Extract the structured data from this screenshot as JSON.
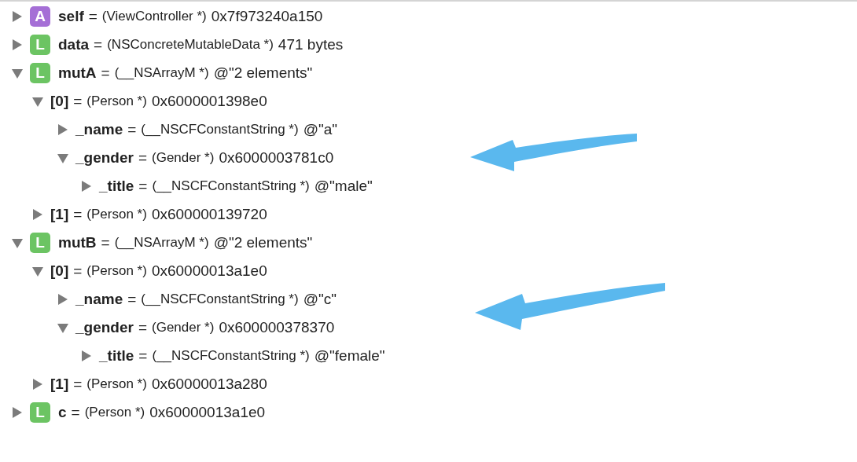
{
  "variables": [
    {
      "name": "self",
      "equals": "=",
      "type": "(ViewController *)",
      "value": "0x7f973240a150",
      "expanded": false,
      "badge": {
        "letter": "A",
        "color": "#a56fd6"
      }
    },
    {
      "name": "data",
      "equals": "=",
      "type": "(NSConcreteMutableData *)",
      "value": "471 bytes",
      "expanded": false,
      "badge": {
        "letter": "L",
        "color": "#6cc463"
      }
    },
    {
      "name": "mutA",
      "equals": "=",
      "type": "(__NSArrayM *)",
      "value": "@\"2 elements\"",
      "expanded": true,
      "badge": {
        "letter": "L",
        "color": "#6cc463"
      },
      "children": [
        {
          "name": "[0]",
          "equals": "=",
          "type": "(Person *)",
          "value": "0x6000001398e0",
          "expanded": true,
          "children": [
            {
              "name": "_name",
              "equals": "=",
              "type": "(__NSCFConstantString *)",
              "value": "@\"a\"",
              "expanded": false
            },
            {
              "name": "_gender",
              "equals": "=",
              "type": "(Gender *)",
              "value": "0x6000003781c0",
              "expanded": true,
              "children": [
                {
                  "name": "_title",
                  "equals": "=",
                  "type": "(__NSCFConstantString *)",
                  "value": "@\"male\"",
                  "expanded": false
                }
              ]
            }
          ]
        },
        {
          "name": "[1]",
          "equals": "=",
          "type": "(Person *)",
          "value": "0x600000139720",
          "expanded": false
        }
      ]
    },
    {
      "name": "mutB",
      "equals": "=",
      "type": "(__NSArrayM *)",
      "value": "@\"2 elements\"",
      "expanded": true,
      "badge": {
        "letter": "L",
        "color": "#6cc463"
      },
      "children": [
        {
          "name": "[0]",
          "equals": "=",
          "type": "(Person *)",
          "value": "0x60000013a1e0",
          "expanded": true,
          "children": [
            {
              "name": "_name",
              "equals": "=",
              "type": "(__NSCFConstantString *)",
              "value": "@\"c\"",
              "expanded": false
            },
            {
              "name": "_gender",
              "equals": "=",
              "type": "(Gender *)",
              "value": "0x600000378370",
              "expanded": true,
              "children": [
                {
                  "name": "_title",
                  "equals": "=",
                  "type": "(__NSCFConstantString *)",
                  "value": "@\"female\"",
                  "expanded": false
                }
              ]
            }
          ]
        },
        {
          "name": "[1]",
          "equals": "=",
          "type": "(Person *)",
          "value": "0x60000013a280",
          "expanded": false
        }
      ]
    },
    {
      "name": "c",
      "equals": "=",
      "type": "(Person *)",
      "value": "0x60000013a1e0",
      "expanded": false,
      "badge": {
        "letter": "L",
        "color": "#6cc463"
      }
    }
  ]
}
